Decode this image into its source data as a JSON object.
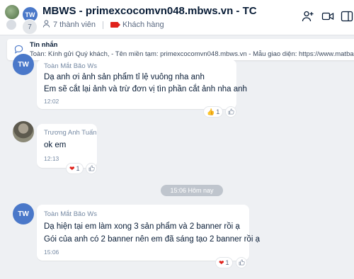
{
  "header": {
    "avatar_initials": "TW",
    "member_overflow": "7",
    "title": "MBWS - primexcocomvn048.mbws.vn - TC",
    "members": "7 thành viên",
    "tag": "Khách hàng",
    "icons": [
      "add-member-icon",
      "video-call-icon",
      "sidebar-toggle-icon"
    ]
  },
  "pinned": {
    "title": "Tin nhắn",
    "text": "Toàn: Kính gửi Quý khách, - Tên miền tạm: primexcocomvn048.mbws.vn - Mẫu giao diện: https://www.matba..."
  },
  "messages": [
    {
      "sender": "Toàn Mắt Bão Ws",
      "avatar": "TW",
      "lines": [
        "Dạ anh ơi ảnh sản phẩm tỉ lệ vuông nha anh",
        "Em sẽ cắt lại ảnh và trừ đơn vị tìn phần cắt ảnh nha anh"
      ],
      "time": "12:02",
      "reaction": {
        "emoji": "👍",
        "count": "1"
      }
    },
    {
      "sender": "Trương Anh Tuấn",
      "lines": [
        "ok em"
      ],
      "time": "12:13",
      "reaction": {
        "emoji": "❤",
        "count": "1"
      }
    },
    {
      "sender": "Toàn Mắt Bão Ws",
      "avatar": "TW",
      "lines": [
        "Dạ hiện tại em làm xong 3 sản phẩm và 2 banner rồi ạ",
        "Gói của anh có 2 banner nên em đã sáng tạo 2 banner rồi ạ"
      ],
      "time": "15:06",
      "reaction": {
        "emoji": "❤",
        "count": "1"
      }
    }
  ],
  "divider": {
    "time_label": "15:06 Hôm nay"
  },
  "colors": {
    "accent": "#4a78c9",
    "tag_red": "#e0211b",
    "background": "#eef0f3"
  }
}
